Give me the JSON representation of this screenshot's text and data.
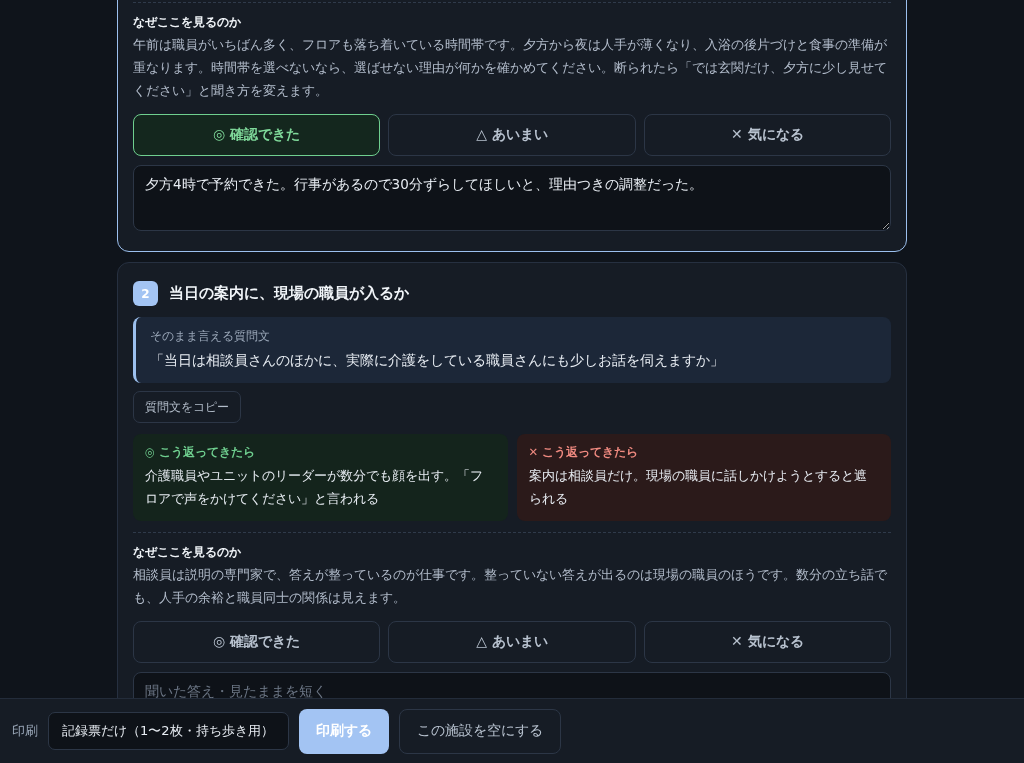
{
  "cards": [
    {
      "active": true,
      "why": {
        "heading": "なぜここを見るのか",
        "text": "午前は職員がいちばん多く、フロアも落ち着いている時間帯です。夕方から夜は人手が薄くなり、入浴の後片づけと食事の準備が重なります。時間帯を選べないなら、選ばせない理由が何かを確かめてください。断られたら「では玄関だけ、夕方に少し見せてください」と聞き方を変えます。"
      },
      "ratings": [
        {
          "label": "◎ 確認できた",
          "kind": "ok",
          "selected": true
        },
        {
          "label": "△ あいまい",
          "kind": "unsure",
          "selected": false
        },
        {
          "label": "✕ 気になる",
          "kind": "concern",
          "selected": false
        }
      ],
      "note": {
        "value": "夕方4時で予約できた。行事があるので30分ずらしてほしいと、理由つきの調整だった。"
      }
    },
    {
      "active": false,
      "number": "2",
      "title": "当日の案内に、現場の職員が入るか",
      "question": {
        "label": "そのまま言える質問文",
        "text": "「当日は相談員さんのほかに、実際に介護をしている職員さんにも少しお話を伺えますか」"
      },
      "copy_button": "質問文をコピー",
      "responses": [
        {
          "kind": "good",
          "label": "◎ こう返ってきたら",
          "text": "介護職員やユニットのリーダーが数分でも顔を出す。「フロアで声をかけてください」と言われる"
        },
        {
          "kind": "bad",
          "label": "✕ こう返ってきたら",
          "text": "案内は相談員だけ。現場の職員に話しかけようとすると遮られる"
        }
      ],
      "why": {
        "heading": "なぜここを見るのか",
        "text": "相談員は説明の専門家で、答えが整っているのが仕事です。整っていない答えが出るのは現場の職員のほうです。数分の立ち話でも、人手の余裕と職員同士の関係は見えます。"
      },
      "ratings": [
        {
          "label": "◎ 確認できた",
          "kind": "ok",
          "selected": false
        },
        {
          "label": "△ あいまい",
          "kind": "unsure",
          "selected": false
        },
        {
          "label": "✕ 気になる",
          "kind": "concern",
          "selected": false
        }
      ],
      "note": {
        "placeholder": "聞いた答え・見たままを短く"
      }
    }
  ],
  "print_bar": {
    "label": "印刷",
    "select": "記録票だけ（1〜2枚・持ち歩き用）",
    "print_button": "印刷する",
    "clear_button": "この施設を空にする"
  }
}
